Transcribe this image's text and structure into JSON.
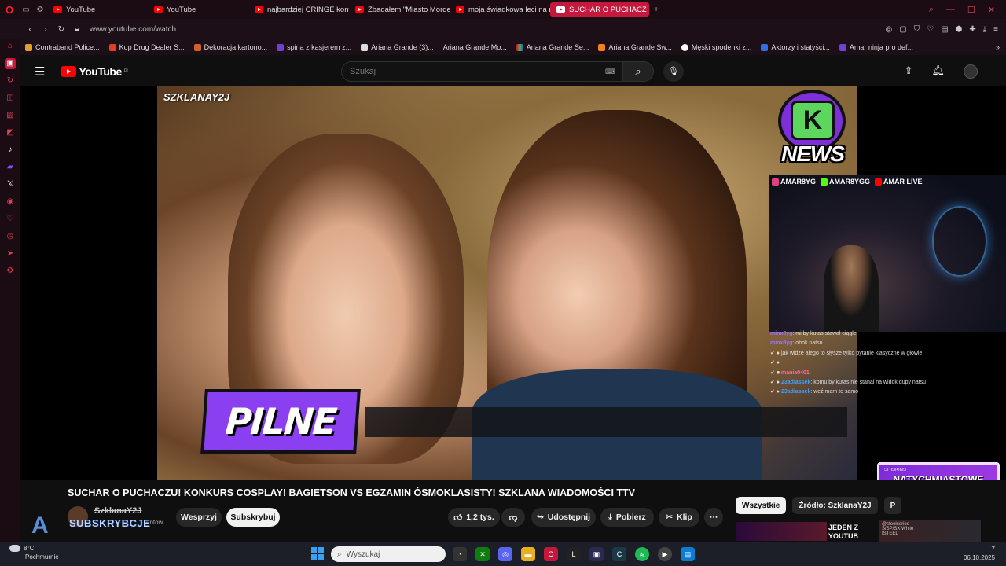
{
  "browser": {
    "tabs": [
      {
        "label": "YouTube",
        "active": false
      },
      {
        "label": "YouTube",
        "active": false
      },
      {
        "label": "najbardziej CRINGE konto",
        "active": false
      },
      {
        "label": "Zbadałem \"Miasto Morde",
        "active": false
      },
      {
        "label": "moja świadkowa leci na m",
        "active": false
      },
      {
        "label": "SUCHAR O PUCHACZ",
        "active": true
      }
    ],
    "url": "www.youtube.com/watch",
    "bookmarks": [
      "Contraband Police...",
      "Kup Drug Dealer S...",
      "Dekoracja kartono...",
      "spina z kasjerem z...",
      "Ariana Grande (3)...",
      "Ariana Grande Mo...",
      "Ariana Grande Se...",
      "Ariana Grande Sw...",
      "Męski spodenki z...",
      "Aktorzy i statyści...",
      "Amar ninja pro def..."
    ]
  },
  "youtube": {
    "logo_text": "YouTube",
    "logo_region": "PL",
    "search_placeholder": "Szukaj"
  },
  "video": {
    "watermark": "SZKLANAY2J",
    "overlay_text": "PILNE",
    "news_logo": "NEWS",
    "stream_socials": [
      "AMAR8YG",
      "AMAR8YGG",
      "AMAR LIVE"
    ],
    "chat": [
      {
        "user": "minx8yg",
        "msg": "mi by kutas stawał ciągle",
        "color": "#a070ff"
      },
      {
        "user": "minx8yg",
        "msg": "obok natsu",
        "color": "#a070ff"
      },
      {
        "user": "",
        "msg": "jak widze alego to słysze tylko pytanie klasyczne w głowie",
        "color": "#ff4060"
      },
      {
        "user": "",
        "msg": "",
        "color": "#ff4060"
      },
      {
        "user": "mania0401",
        "msg": "",
        "color": "#ff6aa0"
      },
      {
        "user": "23adiassek",
        "msg": "komu by kutas nie stanal na widok dupy natsu",
        "color": "#40a0ff"
      },
      {
        "user": "23adiassek",
        "msg": "weź mam to samo",
        "color": "#40a0ff"
      }
    ],
    "ad": {
      "brand": "SHISKINS",
      "text": "NATYCHMIASTOWE WPŁATY SKINAMI!"
    },
    "title": "SUCHAR O PUCHACZU! KONKURS COSPLAY! BAGIETSON VS EGZAMIN ÓSMOKLASISTY! SZKLANA WIADOMOŚCI TTV",
    "channel": "SzklanaY2J",
    "subs_partial": "entów",
    "support_label": "Wesprzyj",
    "subscribe_label": "Subskrybuj",
    "likes": "1,2 tys.",
    "share_label": "Udostępnij",
    "download_label": "Pobierz",
    "clip_label": "Klip",
    "subscribe_overlay": "SUBSKRYBCJE"
  },
  "chips": [
    "Wszystkie",
    "Źródło: SzklanaY2J",
    "P"
  ],
  "recommended": {
    "title_partial": "JEDEN Z YOUTUB",
    "side_text": [
      "@steelseries",
      "S/SP/SX White",
      "ISTEEL"
    ]
  },
  "taskbar": {
    "weather_temp": "8°C",
    "weather_desc": "Pochmurnie",
    "search_placeholder": "Wyszukaj",
    "date": "06.10.2025",
    "time_partial": "7"
  }
}
